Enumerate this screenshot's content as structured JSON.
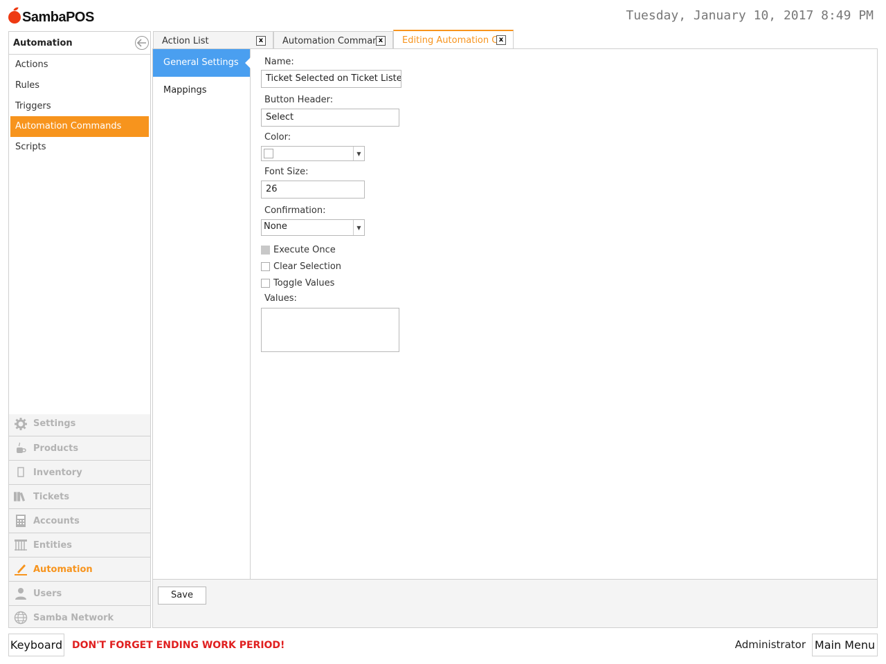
{
  "header": {
    "brand": "SambaPOS",
    "datetime": "Tuesday, January 10, 2017 8:49 PM"
  },
  "left": {
    "title": "Automation",
    "items": [
      {
        "label": "Actions",
        "active": false
      },
      {
        "label": "Rules",
        "active": false
      },
      {
        "label": "Triggers",
        "active": false
      },
      {
        "label": "Automation Commands",
        "active": true
      },
      {
        "label": "Scripts",
        "active": false
      }
    ],
    "sections": [
      {
        "label": "Settings",
        "icon": "gear-icon",
        "active": false
      },
      {
        "label": "Products",
        "icon": "cup-icon",
        "active": false
      },
      {
        "label": "Inventory",
        "icon": "box-icon",
        "active": false
      },
      {
        "label": "Tickets",
        "icon": "books-icon",
        "active": false
      },
      {
        "label": "Accounts",
        "icon": "calculator-icon",
        "active": false
      },
      {
        "label": "Entities",
        "icon": "table-icon",
        "active": false
      },
      {
        "label": "Automation",
        "icon": "pencil-icon",
        "active": true
      },
      {
        "label": "Users",
        "icon": "user-icon",
        "active": false
      },
      {
        "label": "Samba Network",
        "icon": "globe-icon",
        "active": false
      }
    ]
  },
  "tabs": [
    {
      "label": "Action List",
      "close": "x"
    },
    {
      "label": "Automation Comman",
      "close": "x"
    },
    {
      "label": "Editing Automation C",
      "close": "x"
    }
  ],
  "vnav": [
    {
      "label": "General Settings",
      "active": true
    },
    {
      "label": "Mappings",
      "active": false
    }
  ],
  "form": {
    "name_label": "Name:",
    "name_value": "Ticket Selected on Ticket Lister",
    "button_header_label": "Button Header:",
    "button_header_value": "Select",
    "color_label": "Color:",
    "color_value": "#ffffff",
    "font_size_label": "Font Size:",
    "font_size_value": "26",
    "confirmation_label": "Confirmation:",
    "confirmation_value": "None",
    "execute_once": "Execute Once",
    "clear_selection": "Clear Selection",
    "toggle_values": "Toggle Values",
    "values_label": "Values:",
    "values_value": ""
  },
  "footer": {
    "save": "Save"
  },
  "bottom": {
    "keyboard": "Keyboard",
    "warning": "DON'T FORGET ENDING WORK PERIOD!",
    "user": "Administrator",
    "main_menu": "Main Menu"
  },
  "colors": {
    "accent": "#f7941d",
    "selection": "#4a9ff0",
    "warning": "#e02020"
  }
}
